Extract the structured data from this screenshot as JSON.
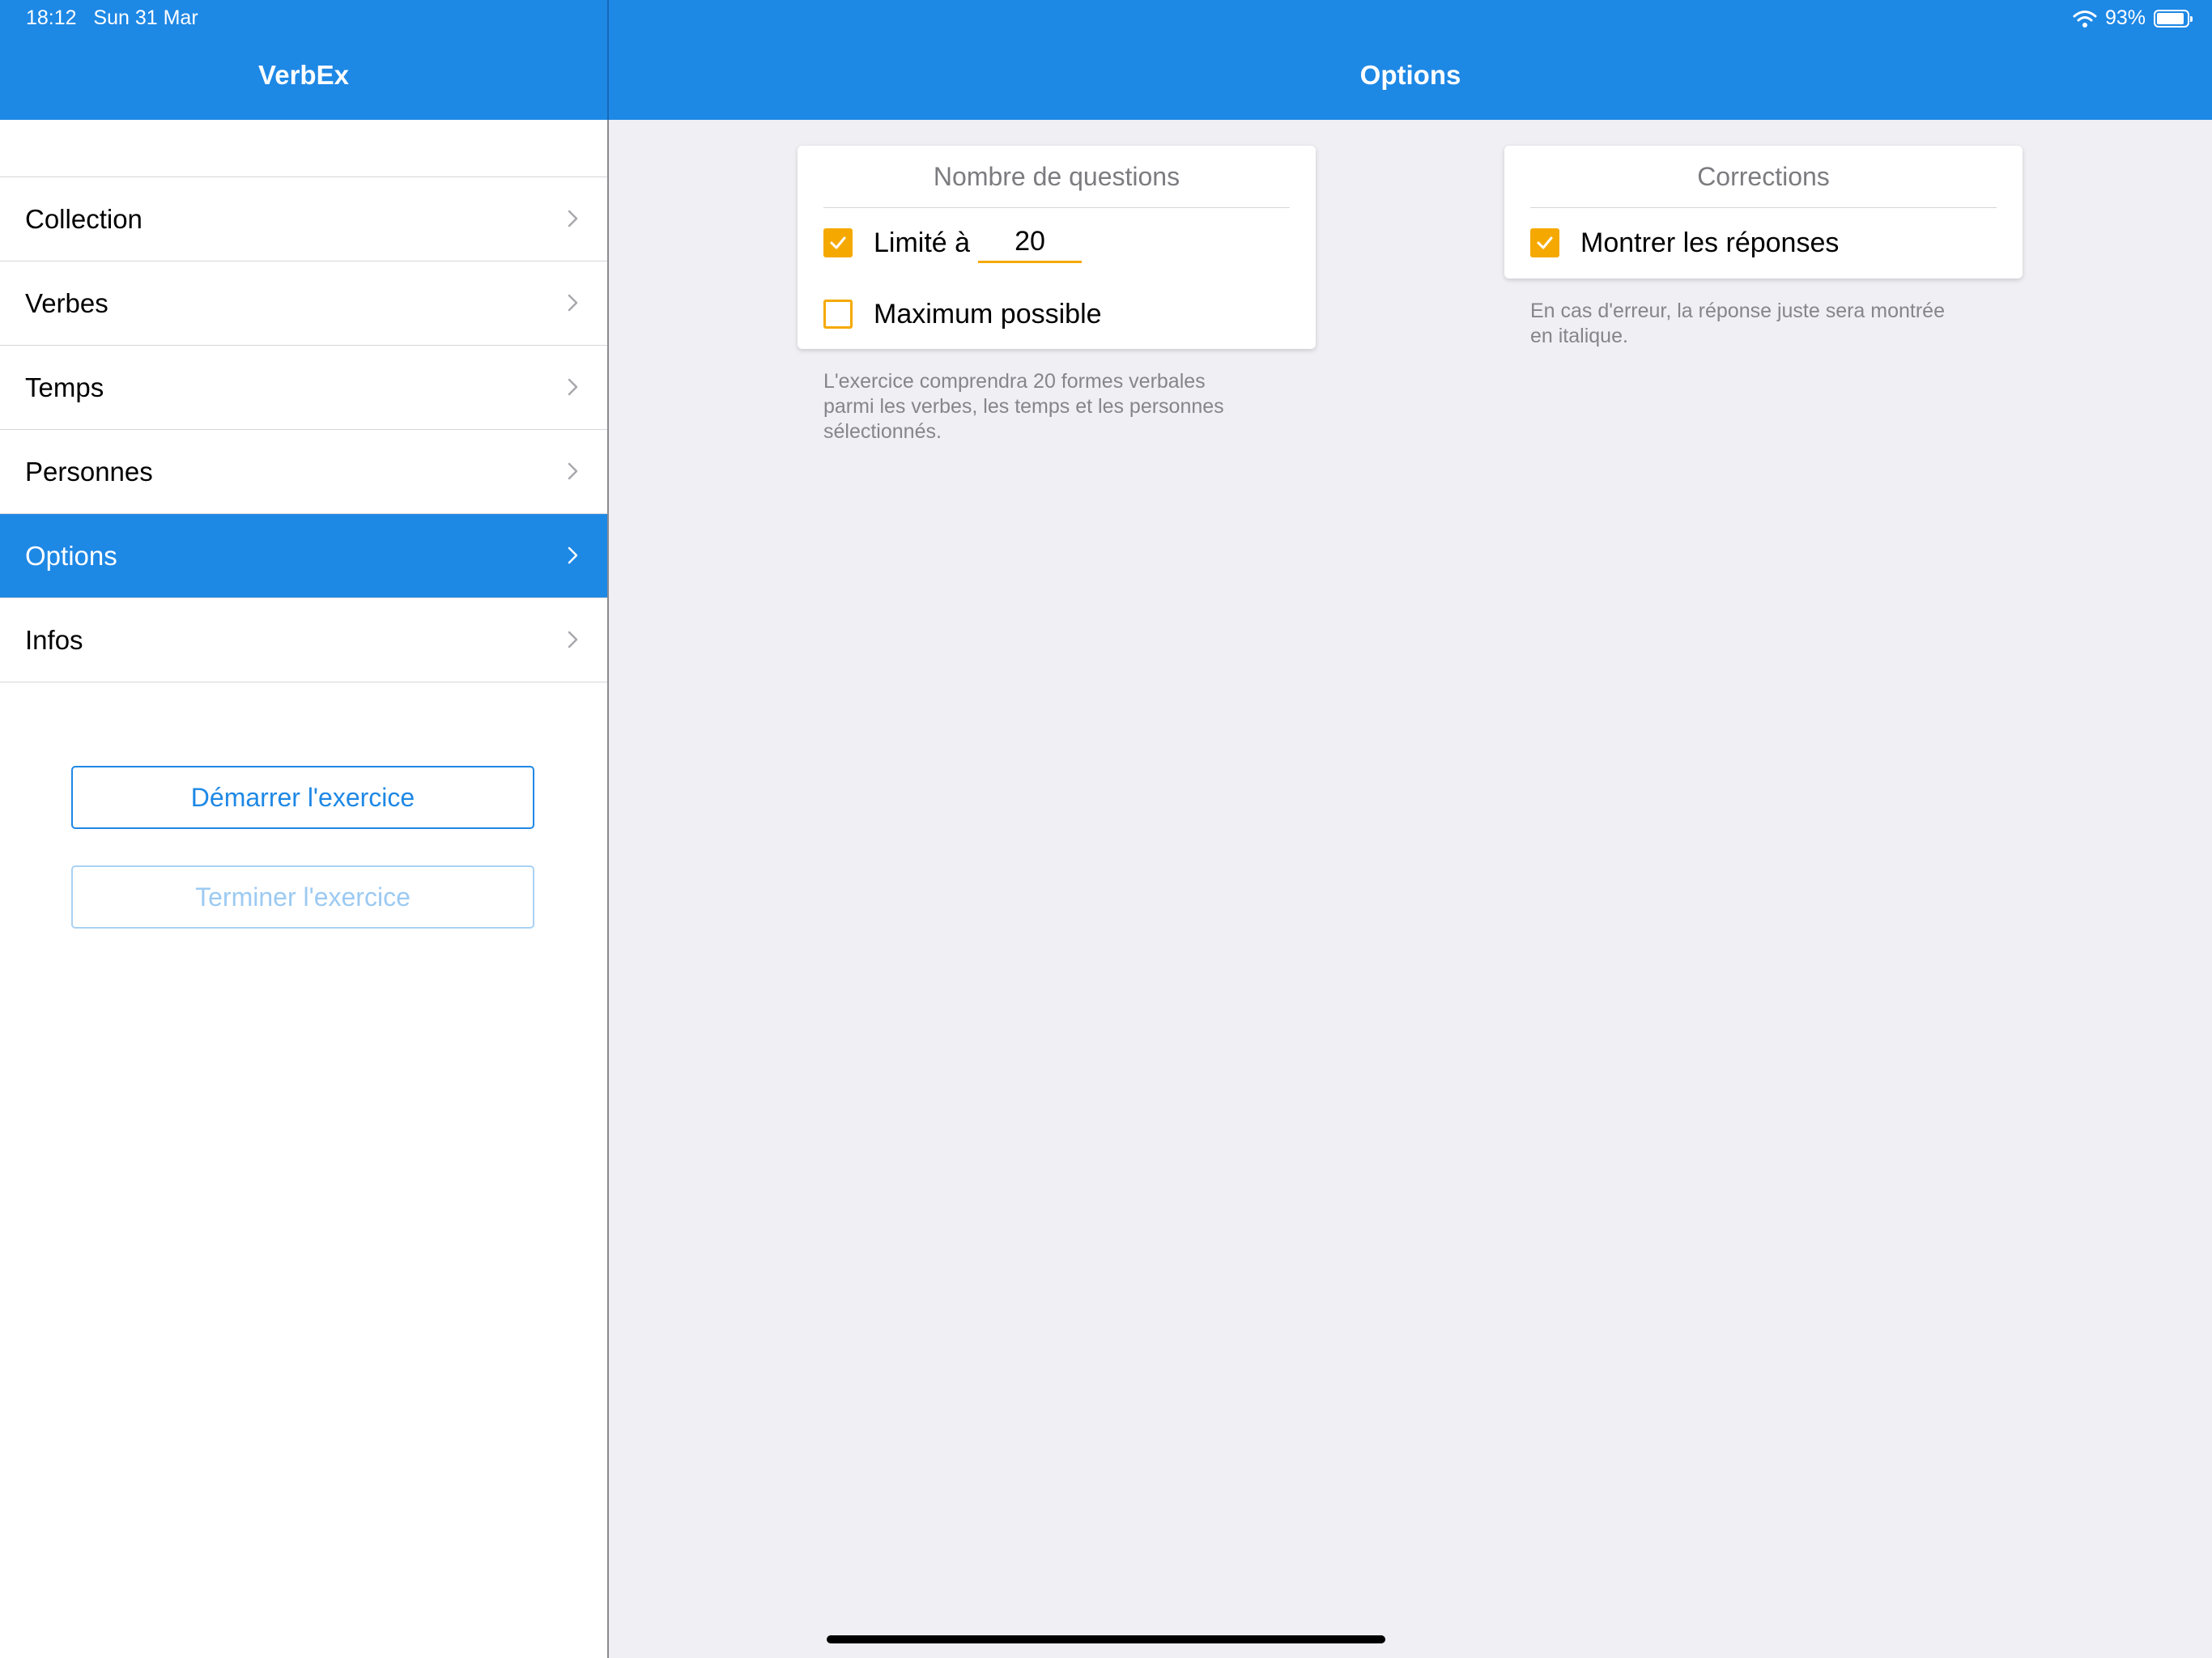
{
  "status_bar": {
    "time": "18:12",
    "date": "Sun 31 Mar",
    "battery_percent_text": "93%",
    "battery_level": 0.93,
    "wifi_icon": "wifi-icon",
    "battery_icon": "battery-icon"
  },
  "colors": {
    "accent": "#1e88e5",
    "checkbox": "#f5a900",
    "background": "#efeff4"
  },
  "sidebar": {
    "title": "VerbEx",
    "items": [
      {
        "label": "Collection",
        "active": false
      },
      {
        "label": "Verbes",
        "active": false
      },
      {
        "label": "Temps",
        "active": false
      },
      {
        "label": "Personnes",
        "active": false
      },
      {
        "label": "Options",
        "active": true
      },
      {
        "label": "Infos",
        "active": false
      }
    ],
    "start_button": "Démarrer l'exercice",
    "end_button": "Terminer l'exercice"
  },
  "main": {
    "title": "Options",
    "questions_card": {
      "title": "Nombre de questions",
      "limit_label": "Limité à",
      "limit_checked": true,
      "limit_value": "20",
      "max_label": "Maximum possible",
      "max_checked": false,
      "helper": "L'exercice comprendra 20 formes verbales\nparmi les verbes, les temps et les personnes\nsélectionnés."
    },
    "corrections_card": {
      "title": "Corrections",
      "show_answers_label": "Montrer les réponses",
      "show_answers_checked": true,
      "helper": "En cas d'erreur, la réponse juste sera montrée\nen italique."
    }
  }
}
